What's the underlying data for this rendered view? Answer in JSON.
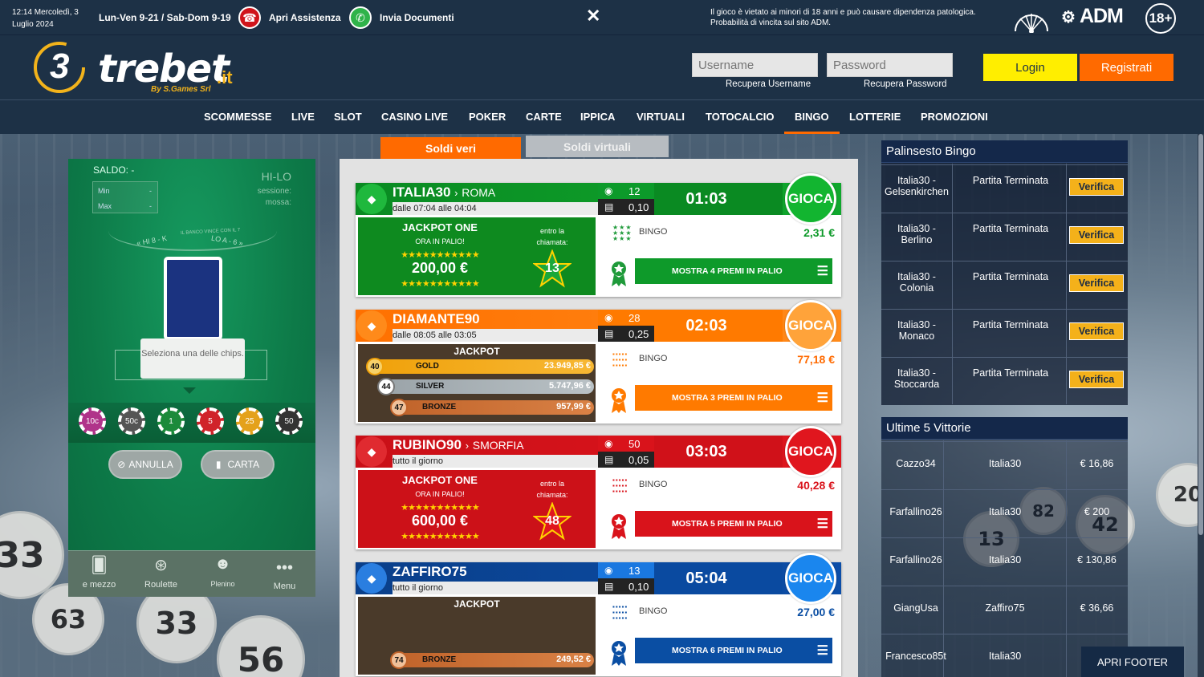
{
  "topbar": {
    "datetime": "12:14 Mercoledì, 3 Luglio 2024",
    "hours": "Lun-Ven 9-21 / Sab-Dom 9-19",
    "assistance": "Apri Assistenza",
    "documents": "Invia Documenti",
    "close": "✕",
    "warning": "Il gioco è vietato ai minori di 18 anni e può causare dipendenza patologica. Probabilità di vincita sul sito ADM.",
    "adm_logo": "ADM",
    "age": "18+"
  },
  "header": {
    "logo_3": "3",
    "logo_brand": "trebet",
    "logo_tld": ".it",
    "logo_by": "By S.Games Srl",
    "username_placeholder": "Username",
    "password_placeholder": "Password",
    "recover_username": "Recupera Username",
    "recover_password": "Recupera Password",
    "login": "Login",
    "register": "Registrati"
  },
  "nav": [
    "SCOMMESSE",
    "LIVE",
    "SLOT",
    "CASINO LIVE",
    "POKER",
    "CARTE",
    "IPPICA",
    "VIRTUALI",
    "TOTOCALCIO",
    "BINGO",
    "LOTTERIE",
    "PROMOZIONI"
  ],
  "nav_active": "BINGO",
  "game": {
    "saldo": "SALDO: -",
    "title": "HI-LO",
    "session_label": "sessione:",
    "bet_label": "mossa:",
    "min_label": "Min",
    "min_val": "-",
    "max_label": "Max",
    "max_val": "-",
    "banco_text": "IL BANCO VINCE CON IL 7",
    "hi_label": "« HI 8 - K",
    "lo_label": "LO A - 6 »",
    "tooltip": "Seleziona una delle chips.",
    "chips": [
      "10c",
      "50c",
      "1",
      "5",
      "25",
      "50"
    ],
    "annulla": "ANNULLA",
    "carta": "CARTA",
    "bottom": [
      "e mezzo",
      "Roulette",
      "Plenino",
      "Menu"
    ]
  },
  "tabs": {
    "real": "Soldi veri",
    "virtual": "Soldi virtuali"
  },
  "rooms": [
    {
      "name": "ITALIA30",
      "extra": "ROMA",
      "when": "dalle 07:04 alle 04:04",
      "players": "12",
      "price": "0,10 €",
      "timer": "01:03",
      "play": "GIOCA",
      "bingo_label": "BINGO",
      "bingo_value": "2,31 €",
      "prizes_btn": "MOSTRA 4 PREMI IN PALIO",
      "jackpot": {
        "title": "JACKPOT ONE",
        "subtitle": "ORA IN PALIO!",
        "value": "200,00 €",
        "within": "entro la chiamata:",
        "call": "13"
      }
    },
    {
      "name": "DIAMANTE90",
      "extra": "",
      "when": "dalle 08:05 alle 03:05",
      "players": "28",
      "price": "0,25 €",
      "timer": "02:03",
      "play": "GIOCA",
      "bingo_label": "BINGO",
      "bingo_value": "77,18 €",
      "prizes_btn": "MOSTRA 3 PREMI IN PALIO",
      "jackpot": {
        "title": "JACKPOT",
        "tiers": [
          {
            "n": "40",
            "name": "GOLD",
            "value": "23.949,85 €"
          },
          {
            "n": "44",
            "name": "SILVER",
            "value": "5.747,96 €"
          },
          {
            "n": "47",
            "name": "BRONZE",
            "value": "957,99 €"
          }
        ]
      }
    },
    {
      "name": "RUBINO90",
      "extra": "SMORFIA",
      "when": "tutto il giorno",
      "players": "50",
      "price": "0,05 €",
      "timer": "03:03",
      "play": "GIOCA",
      "bingo_label": "BINGO",
      "bingo_value": "40,28 €",
      "prizes_btn": "MOSTRA 5 PREMI IN PALIO",
      "jackpot": {
        "title": "JACKPOT ONE",
        "subtitle": "ORA IN PALIO!",
        "value": "600,00 €",
        "within": "entro la chiamata:",
        "call": "48"
      }
    },
    {
      "name": "ZAFFIRO75",
      "extra": "",
      "when": "tutto il giorno",
      "players": "13",
      "price": "0,10 €",
      "timer": "05:04",
      "play": "GIOCA",
      "bingo_label": "BINGO",
      "bingo_value": "27,00 €",
      "prizes_btn": "MOSTRA 6 PREMI IN PALIO",
      "jackpot": {
        "title": "JACKPOT",
        "tiers": [
          {
            "n": "74",
            "name": "BRONZE",
            "value": "249,52 €"
          }
        ]
      }
    }
  ],
  "palinsesto": {
    "title": "Palinsesto Bingo",
    "rows": [
      {
        "room": "Italia30 - Gelsenkirchen",
        "status": "Partita Terminata",
        "action": "Verifica"
      },
      {
        "room": "Italia30 - Berlino",
        "status": "Partita Terminata",
        "action": "Verifica"
      },
      {
        "room": "Italia30 - Colonia",
        "status": "Partita Terminata",
        "action": "Verifica"
      },
      {
        "room": "Italia30 - Monaco",
        "status": "Partita Terminata",
        "action": "Verifica"
      },
      {
        "room": "Italia30 - Stoccarda",
        "status": "Partita Terminata",
        "action": "Verifica"
      }
    ]
  },
  "vittorie": {
    "title": "Ultime 5 Vittorie",
    "rows": [
      {
        "user": "Cazzo34",
        "room": "Italia30",
        "amount": "€ 16,86"
      },
      {
        "user": "Farfallino26",
        "room": "Italia30",
        "amount": "€ 200"
      },
      {
        "user": "Farfallino26",
        "room": "Italia30",
        "amount": "€ 130,86"
      },
      {
        "user": "GiangUsa",
        "room": "Zaffiro75",
        "amount": "€ 36,66"
      },
      {
        "user": "Francesco85t",
        "room": "Italia30",
        "amount": ""
      }
    ]
  },
  "footer_btn": "APRI FOOTER",
  "colors": {
    "green": "#0a9a2a",
    "orange": "#ff7a00",
    "red": "#d9131b",
    "blue": "#0a4ea3",
    "accent": "#ff6a00",
    "login": "#ffee00"
  }
}
